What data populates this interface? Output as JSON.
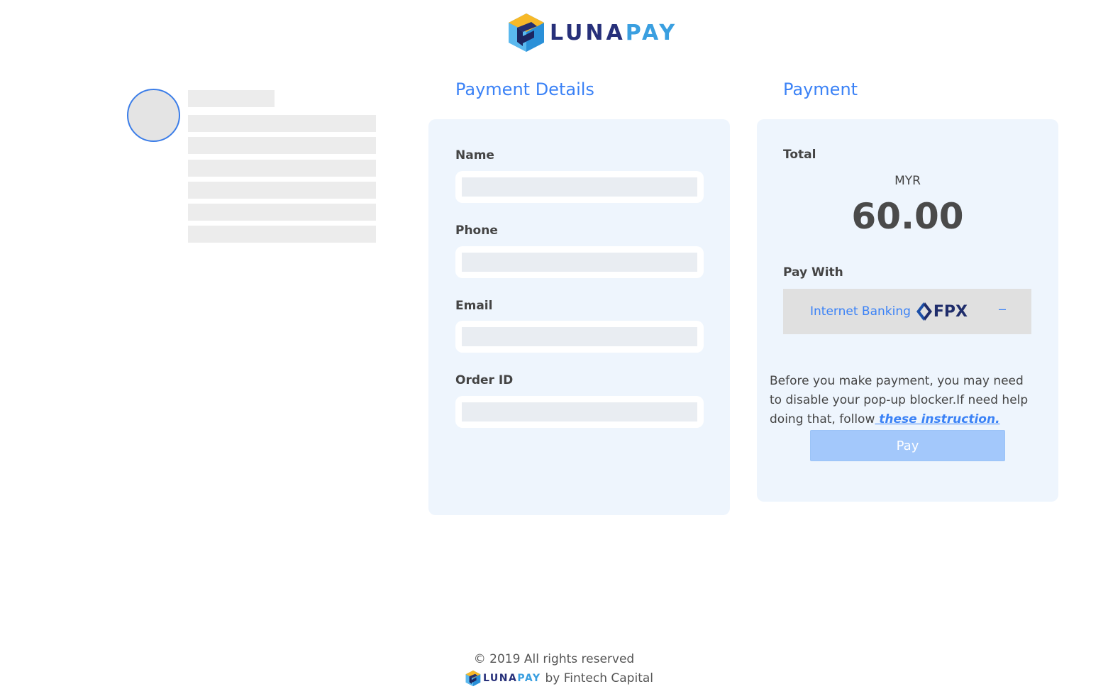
{
  "brand": {
    "part1": "LUNA",
    "part2": "PAY"
  },
  "details": {
    "title": "Payment Details",
    "fields": [
      {
        "label": "Name",
        "value": ""
      },
      {
        "label": "Phone",
        "value": ""
      },
      {
        "label": "Email",
        "value": ""
      },
      {
        "label": "Order ID",
        "value": ""
      }
    ]
  },
  "payment": {
    "title": "Payment",
    "total_label": "Total",
    "currency": "MYR",
    "amount": "60.00",
    "pay_with_label": "Pay With",
    "method_label": "Internet Banking",
    "method_logo_text": "FPX",
    "method_toggle": "–",
    "notice_text": "Before you make payment, you may need to disable your pop-up blocker.If need help doing that, follow",
    "notice_link": " these instruction.",
    "pay_button": "Pay"
  },
  "footer": {
    "copyright": "© 2019 All rights reserved",
    "brand_part1": "LUNA",
    "brand_part2": "PAY",
    "by_line": "by Fintech Capital"
  },
  "colors": {
    "accent": "#3b82f6",
    "card_bg": "#eef5fd",
    "pay_button_bg": "#a3c8fb",
    "brand_dark": "#27307a",
    "brand_light": "#3a9fe0"
  }
}
